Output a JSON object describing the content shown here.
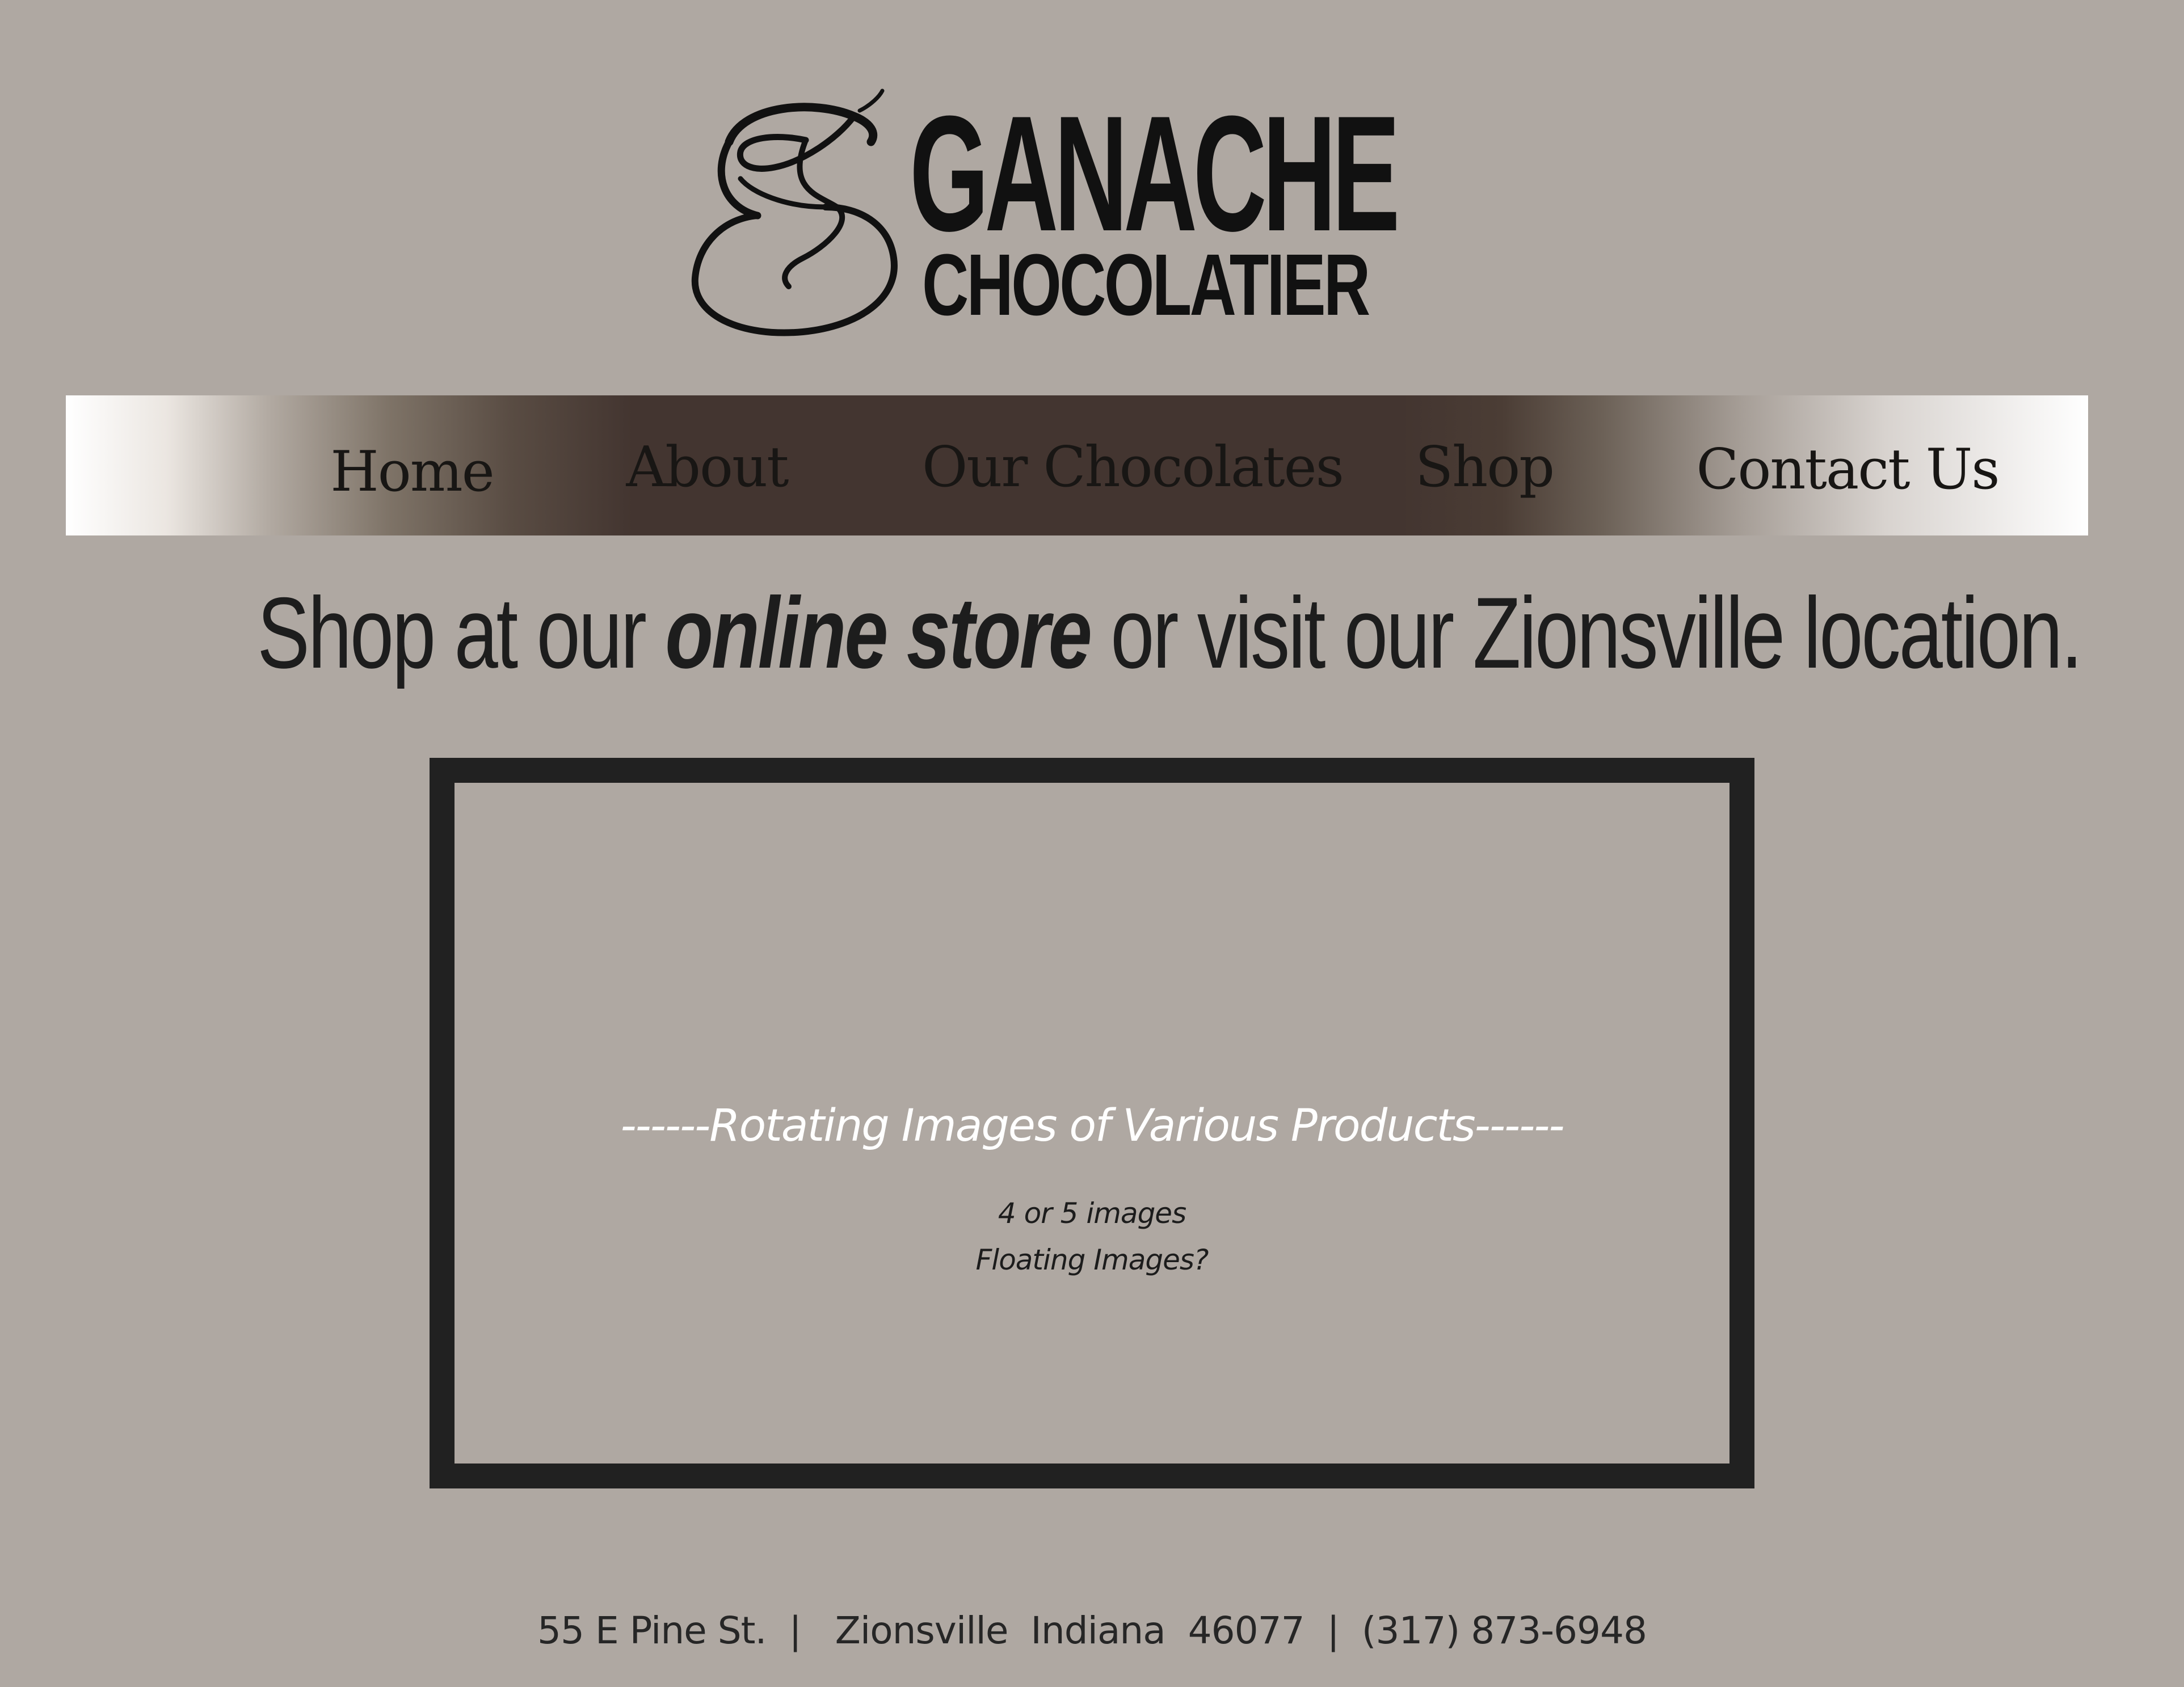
{
  "header": {
    "logo_title": "GANACHE",
    "logo_subtitle": "CHOCOLATIER",
    "logo_mark_icon": "script-g-monogram-icon"
  },
  "nav": {
    "items": [
      {
        "label": "Home"
      },
      {
        "label": "About"
      },
      {
        "label": "Our Chocolates"
      },
      {
        "label": "Shop"
      },
      {
        "label": "Contact Us"
      }
    ]
  },
  "tagline": {
    "before": "Shop at our ",
    "emphasis": "online store",
    "after": " or visit our Zionsville location."
  },
  "slider": {
    "title": "------Rotating Images of Various Products------",
    "note_1": "4 or 5 images",
    "note_2": "Floating Images?"
  },
  "footer": {
    "address": "55 E Pine St.",
    "sep_1": "  |   ",
    "city_state_zip": "Zionsville  Indiana  46077",
    "sep_2": "  |  ",
    "phone": "(317) 873-6948"
  },
  "colors": {
    "background": "#afa8a2",
    "nav_dark": "#433530",
    "text_dark": "#1f1f1f",
    "border": "#212121"
  }
}
